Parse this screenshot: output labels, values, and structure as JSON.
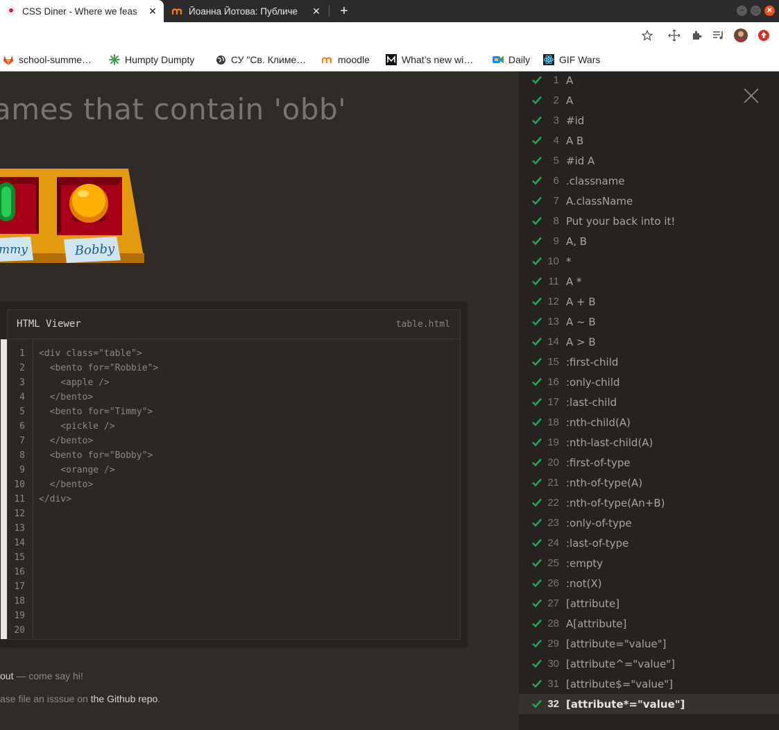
{
  "browser": {
    "tabs": [
      {
        "title": "CSS Diner - Where we feas",
        "active": true,
        "icon": "css-diner-favicon"
      },
      {
        "title": "Йоанна Йотова: Публиче",
        "active": false,
        "icon": "moodle-favicon"
      }
    ],
    "close_glyph": "✕",
    "new_tab_glyph": "+",
    "window_buttons": [
      "−",
      "□",
      "✕"
    ],
    "toolbar_icons": [
      "star-icon",
      "move-icon",
      "extensions-icon",
      "media-icon",
      "profile-avatar",
      "update-icon"
    ],
    "bookmarks": [
      {
        "label": "school-summe…",
        "icon": "gitlab-icon"
      },
      {
        "label": "Humpty Dumpty",
        "icon": "leaf-icon"
      },
      {
        "label": "СУ \"Св. Климе…",
        "icon": "globe-icon"
      },
      {
        "label": "moodle",
        "icon": "moodle-icon"
      },
      {
        "label": "What’s new wi…",
        "icon": "medium-icon"
      },
      {
        "label": "Daily",
        "icon": "daily-icon"
      },
      {
        "label": "GIF Wars",
        "icon": "react-icon"
      }
    ],
    "accent_colors": {
      "tab_bar": "#2b2b2b",
      "close_button": "#e95420",
      "check": "#25a35a"
    }
  },
  "page": {
    "heading": "ames that contain 'obb'",
    "illustration": {
      "bentos": [
        "Timmy",
        "Bobby"
      ],
      "label_partial": "mmy",
      "label_full": "Bobby"
    },
    "viewer": {
      "title": "HTML Viewer",
      "filename": "table.html",
      "line_numbers": [
        "1",
        "2",
        "3",
        "4",
        "5",
        "6",
        "7",
        "8",
        "9",
        "10",
        "11",
        "12",
        "13",
        "14",
        "15",
        "16",
        "17",
        "18",
        "19",
        "20"
      ],
      "code_lines": [
        "<div class=\"table\">",
        "  <bento for=\"Robbie\">",
        "    <apple />",
        "  </bento>",
        "  <bento for=\"Timmy\">",
        "    <pickle />",
        "  </bento>",
        "  <bento for=\"Bobby\">",
        "    <orange />",
        "  </bento>",
        "</div>"
      ]
    },
    "footer": {
      "line1_link": "out",
      "line1_rest": " — come say hi!",
      "line2_text": "ase file an isssue on ",
      "line2_link": "the Github repo",
      "line2_end": "."
    }
  },
  "levels": {
    "current": "32",
    "items": [
      {
        "num": "1",
        "name": "A"
      },
      {
        "num": "2",
        "name": "A"
      },
      {
        "num": "3",
        "name": "#id"
      },
      {
        "num": "4",
        "name": "A  B"
      },
      {
        "num": "5",
        "name": "#id  A"
      },
      {
        "num": "6",
        "name": ".classname"
      },
      {
        "num": "7",
        "name": "A.className"
      },
      {
        "num": "8",
        "name": "Put your back into it!"
      },
      {
        "num": "9",
        "name": "A, B"
      },
      {
        "num": "10",
        "name": "*"
      },
      {
        "num": "11",
        "name": "A  *"
      },
      {
        "num": "12",
        "name": "A + B"
      },
      {
        "num": "13",
        "name": "A ~ B"
      },
      {
        "num": "14",
        "name": "A > B"
      },
      {
        "num": "15",
        "name": ":first-child"
      },
      {
        "num": "16",
        "name": ":only-child"
      },
      {
        "num": "17",
        "name": ":last-child"
      },
      {
        "num": "18",
        "name": ":nth-child(A)"
      },
      {
        "num": "19",
        "name": ":nth-last-child(A)"
      },
      {
        "num": "20",
        "name": ":first-of-type"
      },
      {
        "num": "21",
        "name": ":nth-of-type(A)"
      },
      {
        "num": "22",
        "name": ":nth-of-type(An+B)"
      },
      {
        "num": "23",
        "name": ":only-of-type"
      },
      {
        "num": "24",
        "name": ":last-of-type"
      },
      {
        "num": "25",
        "name": ":empty"
      },
      {
        "num": "26",
        "name": ":not(X)"
      },
      {
        "num": "27",
        "name": "[attribute]"
      },
      {
        "num": "28",
        "name": "A[attribute]"
      },
      {
        "num": "29",
        "name": "[attribute=\"value\"]"
      },
      {
        "num": "30",
        "name": "[attribute^=\"value\"]"
      },
      {
        "num": "31",
        "name": "[attribute$=\"value\"]"
      },
      {
        "num": "32",
        "name": "[attribute*=\"value\"]"
      }
    ]
  }
}
